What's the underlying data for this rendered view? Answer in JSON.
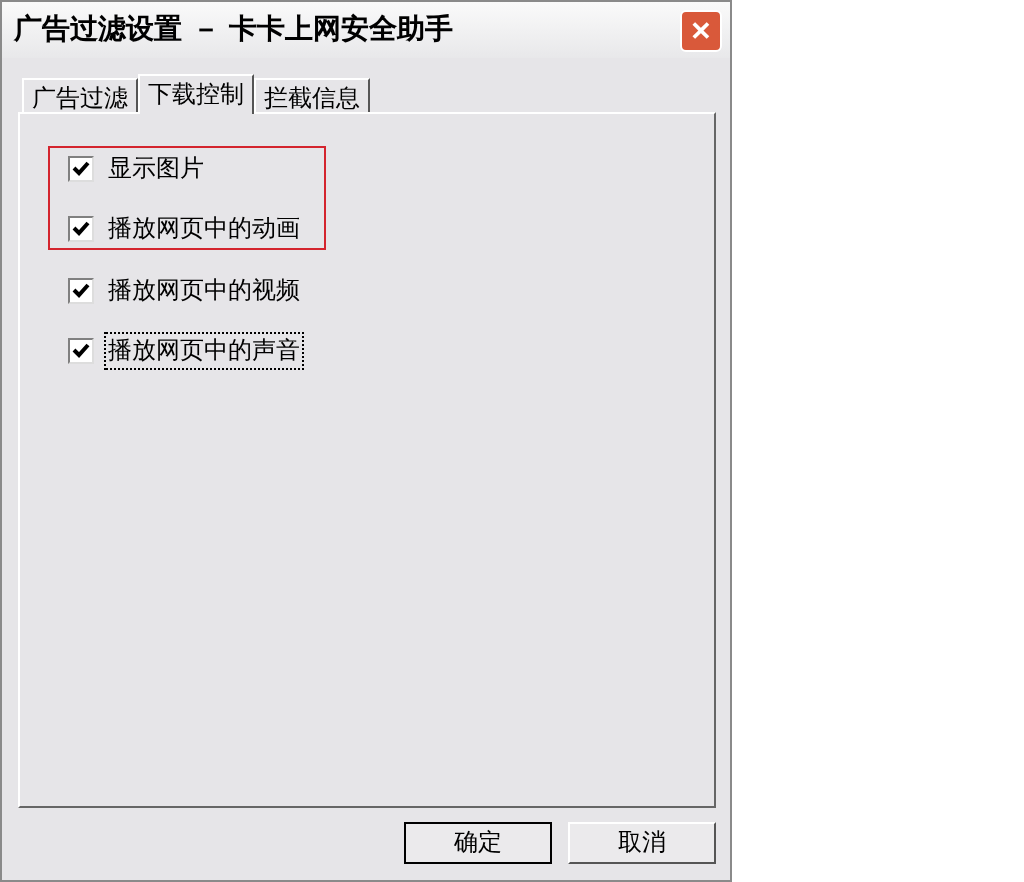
{
  "window": {
    "title": "广告过滤设置 － 卡卡上网安全助手",
    "close_button": "✕"
  },
  "tabs": [
    {
      "label": "广告过滤",
      "selected": false
    },
    {
      "label": "下载控制",
      "selected": true
    },
    {
      "label": "拦截信息",
      "selected": false
    }
  ],
  "options": [
    {
      "label": "显示图片",
      "checked": true,
      "highlighted": true,
      "focused": false
    },
    {
      "label": "播放网页中的动画",
      "checked": true,
      "highlighted": true,
      "focused": false
    },
    {
      "label": "播放网页中的视频",
      "checked": true,
      "highlighted": false,
      "focused": false
    },
    {
      "label": "播放网页中的声音",
      "checked": true,
      "highlighted": false,
      "focused": true
    }
  ],
  "buttons": [
    {
      "label": "确定",
      "default": true
    },
    {
      "label": "取消",
      "default": false
    }
  ]
}
